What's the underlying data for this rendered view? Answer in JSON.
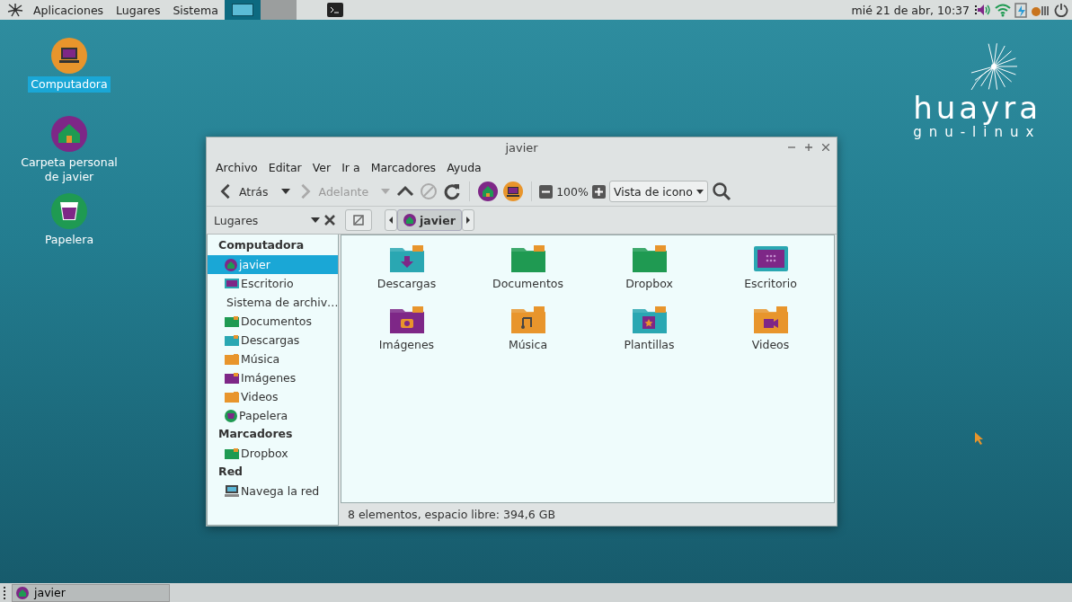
{
  "top_panel": {
    "menus": [
      {
        "label": "Aplicaciones"
      },
      {
        "label": "Lugares"
      },
      {
        "label": "Sistema"
      }
    ],
    "workspaces": [
      {
        "selected": true
      },
      {
        "selected": false
      }
    ],
    "clock": "mié 21 de abr, 10:37"
  },
  "desktop_icons": [
    {
      "label": "Computadora",
      "kind": "computer",
      "selected": true
    },
    {
      "label": "Carpeta personal de javier",
      "kind": "home",
      "selected": false
    },
    {
      "label": "Papelera",
      "kind": "trash",
      "selected": false
    }
  ],
  "logo": {
    "name": "huayra",
    "subtitle": "gnu-linux"
  },
  "window": {
    "title": "javier",
    "menu": [
      {
        "label": "Archivo"
      },
      {
        "label": "Editar"
      },
      {
        "label": "Ver"
      },
      {
        "label": "Ir a"
      },
      {
        "label": "Marcadores"
      },
      {
        "label": "Ayuda"
      }
    ],
    "toolbar": {
      "back": {
        "label": "Atrás",
        "disabled": false
      },
      "forward": {
        "label": "Adelante",
        "disabled": true
      },
      "zoom": "100%",
      "view": "Vista de icono"
    },
    "sidebar": {
      "title": "Lugares",
      "sections": [
        {
          "heading": "Computadora",
          "items": [
            {
              "label": "javier",
              "kind": "home",
              "selected": true
            },
            {
              "label": "Escritorio",
              "kind": "desktop",
              "selected": false
            },
            {
              "label": "Sistema de archiv…",
              "kind": "drive",
              "selected": false
            },
            {
              "label": "Documentos",
              "kind": "folder",
              "color": "#1f9a52",
              "selected": false
            },
            {
              "label": "Descargas",
              "kind": "folder",
              "color": "#2aa7b2",
              "selected": false
            },
            {
              "label": "Música",
              "kind": "folder",
              "color": "#e8952c",
              "selected": false
            },
            {
              "label": "Imágenes",
              "kind": "folder",
              "color": "#7e2787",
              "selected": false
            },
            {
              "label": "Videos",
              "kind": "folder",
              "color": "#e8952c",
              "selected": false
            },
            {
              "label": "Papelera",
              "kind": "trash",
              "selected": false
            }
          ]
        },
        {
          "heading": "Marcadores",
          "items": [
            {
              "label": "Dropbox",
              "kind": "folder",
              "color": "#1f9a52",
              "selected": false
            }
          ]
        },
        {
          "heading": "Red",
          "items": [
            {
              "label": "Navega la red",
              "kind": "network",
              "selected": false
            }
          ]
        }
      ]
    },
    "path": [
      {
        "label": "javier",
        "selected": true
      }
    ],
    "files": [
      {
        "label": "Descargas",
        "kind": "download",
        "color": "#2aa7b2"
      },
      {
        "label": "Documentos",
        "kind": "plain",
        "color": "#1f9a52"
      },
      {
        "label": "Dropbox",
        "kind": "plain",
        "color": "#1f9a52"
      },
      {
        "label": "Escritorio",
        "kind": "desktop",
        "color": "#2aa7b2"
      },
      {
        "label": "Imágenes",
        "kind": "camera",
        "color": "#7e2787"
      },
      {
        "label": "Música",
        "kind": "music",
        "color": "#e8952c"
      },
      {
        "label": "Plantillas",
        "kind": "template",
        "color": "#2aa7b2"
      },
      {
        "label": "Videos",
        "kind": "video",
        "color": "#e8952c"
      }
    ],
    "status": "8 elementos, espacio libre: 394,6 GB"
  },
  "taskbar": {
    "tasks": [
      {
        "label": "javier",
        "selected": false
      }
    ]
  }
}
